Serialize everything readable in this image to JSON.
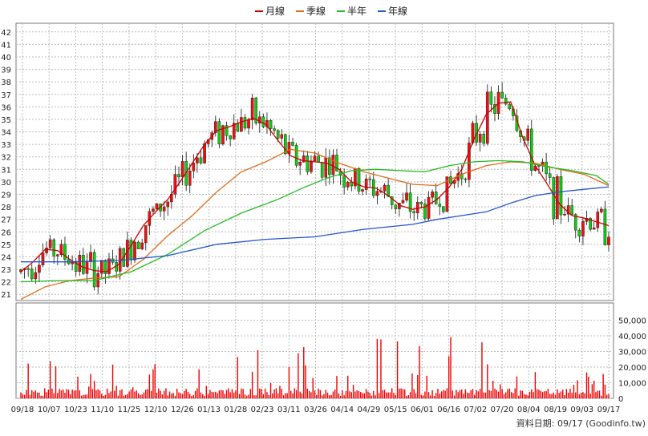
{
  "chart_data": {
    "type": "line",
    "legend": {
      "placement": "top-center",
      "items": [
        {
          "name": "月線",
          "color": "#cc0000"
        },
        {
          "name": "季線",
          "color": "#e06a1b"
        },
        {
          "name": "半年",
          "color": "#22bb22"
        },
        {
          "name": "年線",
          "color": "#2255cc"
        }
      ]
    },
    "price_axis": {
      "ylim": [
        20.5,
        42.5
      ],
      "ticks": [
        21,
        22,
        23,
        24,
        25,
        26,
        27,
        28,
        29,
        30,
        31,
        32,
        33,
        34,
        35,
        36,
        37,
        38,
        39,
        40,
        41,
        42
      ],
      "side": "left"
    },
    "volume_axis": {
      "ylim": [
        0,
        60000
      ],
      "ticks": [
        0,
        10000,
        20000,
        30000,
        40000,
        50000
      ],
      "tick_labels": [
        "0",
        "10,000",
        "20,000",
        "30,000",
        "40,000",
        "50,000"
      ],
      "side": "right"
    },
    "x_dates": [
      "09/18",
      "10/07",
      "10/23",
      "11/10",
      "11/25",
      "12/10",
      "12/26",
      "01/13",
      "01/28",
      "02/23",
      "03/11",
      "03/26",
      "04/14",
      "04/29",
      "05/15",
      "06/01",
      "06/16",
      "07/02",
      "07/20",
      "08/04",
      "08/19",
      "09/03",
      "09/17"
    ],
    "grid": true,
    "candle_colors": {
      "up": "#ee1111",
      "down": "#11cc11"
    },
    "volume_color": "#ee0000",
    "series": [
      {
        "name": "月線",
        "color": "#cc0000",
        "values": [
          [
            0,
            22.8
          ],
          [
            10,
            23.6
          ],
          [
            20,
            24.6
          ],
          [
            30,
            24.5
          ],
          [
            40,
            23.8
          ],
          [
            50,
            23.2
          ],
          [
            60,
            22.9
          ],
          [
            70,
            22.8
          ],
          [
            80,
            23.4
          ],
          [
            90,
            24.9
          ],
          [
            100,
            26.5
          ],
          [
            110,
            27.6
          ],
          [
            120,
            28.6
          ],
          [
            130,
            30.0
          ],
          [
            140,
            31.5
          ],
          [
            150,
            33.0
          ],
          [
            160,
            34.1
          ],
          [
            170,
            34.4
          ],
          [
            180,
            34.8
          ],
          [
            190,
            35.1
          ],
          [
            200,
            34.6
          ],
          [
            210,
            33.3
          ],
          [
            220,
            32.1
          ],
          [
            230,
            31.7
          ],
          [
            240,
            31.6
          ],
          [
            250,
            31.5
          ],
          [
            260,
            31.0
          ],
          [
            270,
            30.0
          ],
          [
            280,
            29.6
          ],
          [
            290,
            29.5
          ],
          [
            300,
            28.9
          ],
          [
            310,
            28.1
          ],
          [
            320,
            27.8
          ],
          [
            330,
            28.0
          ],
          [
            340,
            28.6
          ],
          [
            350,
            29.6
          ],
          [
            360,
            31.0
          ],
          [
            370,
            33.4
          ],
          [
            380,
            35.4
          ],
          [
            390,
            36.3
          ],
          [
            400,
            36.4
          ],
          [
            410,
            33.5
          ],
          [
            420,
            31.3
          ],
          [
            430,
            29.8
          ],
          [
            440,
            28.2
          ],
          [
            450,
            27.3
          ],
          [
            460,
            27.1
          ],
          [
            470,
            26.8
          ],
          [
            480,
            26.5
          ]
        ]
      },
      {
        "name": "季線",
        "color": "#e06a1b",
        "values": [
          [
            0,
            20.6
          ],
          [
            20,
            21.6
          ],
          [
            40,
            22.1
          ],
          [
            60,
            22.3
          ],
          [
            80,
            22.4
          ],
          [
            100,
            23.8
          ],
          [
            120,
            25.7
          ],
          [
            140,
            27.3
          ],
          [
            160,
            29.2
          ],
          [
            180,
            30.8
          ],
          [
            200,
            31.6
          ],
          [
            220,
            32.6
          ],
          [
            240,
            32.3
          ],
          [
            260,
            31.5
          ],
          [
            280,
            30.8
          ],
          [
            300,
            30.3
          ],
          [
            320,
            29.8
          ],
          [
            340,
            29.7
          ],
          [
            360,
            30.6
          ],
          [
            380,
            31.3
          ],
          [
            400,
            31.6
          ],
          [
            420,
            31.5
          ],
          [
            440,
            31.0
          ],
          [
            460,
            30.6
          ],
          [
            480,
            29.7
          ]
        ]
      },
      {
        "name": "半年",
        "color": "#22bb22",
        "values": [
          [
            0,
            22.0
          ],
          [
            30,
            22.1
          ],
          [
            60,
            22.1
          ],
          [
            90,
            22.8
          ],
          [
            120,
            24.2
          ],
          [
            150,
            26.1
          ],
          [
            180,
            27.5
          ],
          [
            210,
            28.6
          ],
          [
            230,
            29.5
          ],
          [
            250,
            30.3
          ],
          [
            270,
            30.9
          ],
          [
            290,
            31.0
          ],
          [
            310,
            30.9
          ],
          [
            330,
            30.8
          ],
          [
            350,
            31.3
          ],
          [
            370,
            31.6
          ],
          [
            390,
            31.7
          ],
          [
            410,
            31.6
          ],
          [
            430,
            31.2
          ],
          [
            450,
            30.9
          ],
          [
            470,
            30.5
          ],
          [
            480,
            29.8
          ]
        ]
      },
      {
        "name": "年線",
        "color": "#2255cc",
        "values": [
          [
            0,
            23.6
          ],
          [
            40,
            23.6
          ],
          [
            80,
            23.7
          ],
          [
            120,
            24.1
          ],
          [
            160,
            25.0
          ],
          [
            200,
            25.4
          ],
          [
            240,
            25.6
          ],
          [
            280,
            26.2
          ],
          [
            320,
            26.6
          ],
          [
            340,
            27.0
          ],
          [
            360,
            27.3
          ],
          [
            380,
            27.6
          ],
          [
            400,
            28.3
          ],
          [
            420,
            28.9
          ],
          [
            440,
            29.2
          ],
          [
            460,
            29.4
          ],
          [
            480,
            29.6
          ]
        ]
      }
    ],
    "annotation": "資料日期: 09/17  (Goodinfo.tw)"
  }
}
